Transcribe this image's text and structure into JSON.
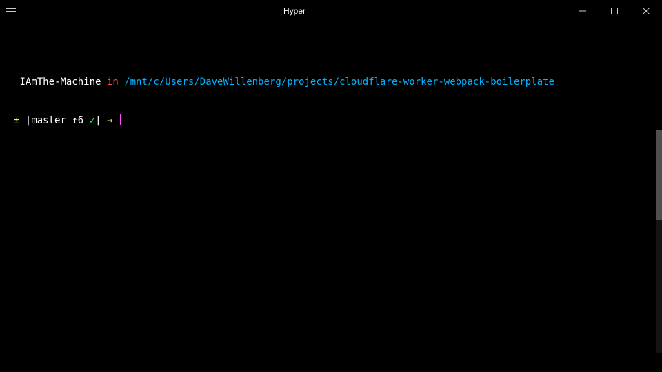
{
  "window": {
    "title": "Hyper"
  },
  "prompt": {
    "hostname": "IAmThe-Machine",
    "sep_in": "in",
    "cwd": "/mnt/c/Users/DaveWillenberg/projects/cloudflare-worker-webpack-boilerplate",
    "vcs_symbol": "±",
    "bar": "|",
    "branch": "master",
    "ahead": "↑6",
    "clean": "✓",
    "bar2": "|",
    "arrow": "→"
  },
  "scrollbar": {
    "visible": true
  }
}
